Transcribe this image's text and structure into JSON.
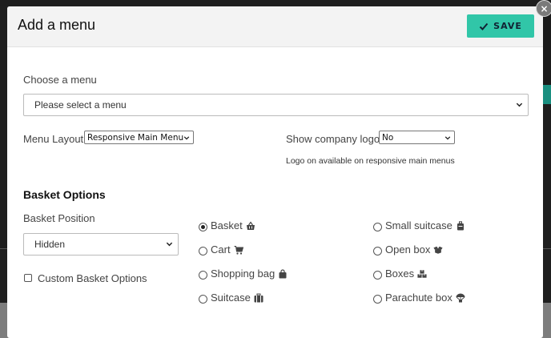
{
  "modal": {
    "title": "Add a menu",
    "save_label": "SAVE",
    "close_glyph": "×"
  },
  "menu_select": {
    "label": "Choose a menu",
    "value": "Please select a menu"
  },
  "menu_layout": {
    "label": "Menu Layout",
    "value": "Responsive Main Menu"
  },
  "company_logo": {
    "label": "Show company logo",
    "value": "No",
    "note": "Logo on available on responsive main menus"
  },
  "basket": {
    "section_title": "Basket Options",
    "position_label": "Basket Position",
    "position_value": "Hidden",
    "custom_label": "Custom Basket Options",
    "custom_checked": false,
    "selected": "Basket",
    "options_col1": [
      {
        "label": "Basket",
        "icon": "basket-icon"
      },
      {
        "label": "Cart",
        "icon": "cart-icon"
      },
      {
        "label": "Shopping bag",
        "icon": "shopping-bag-icon"
      },
      {
        "label": "Suitcase",
        "icon": "suitcase-icon"
      }
    ],
    "options_col2": [
      {
        "label": "Small suitcase",
        "icon": "small-suitcase-icon"
      },
      {
        "label": "Open box",
        "icon": "open-box-icon"
      },
      {
        "label": "Boxes",
        "icon": "boxes-icon"
      },
      {
        "label": "Parachute box",
        "icon": "parachute-box-icon"
      }
    ]
  },
  "colors": {
    "accent": "#31c6a8",
    "header_bg": "#f3f3f3"
  }
}
